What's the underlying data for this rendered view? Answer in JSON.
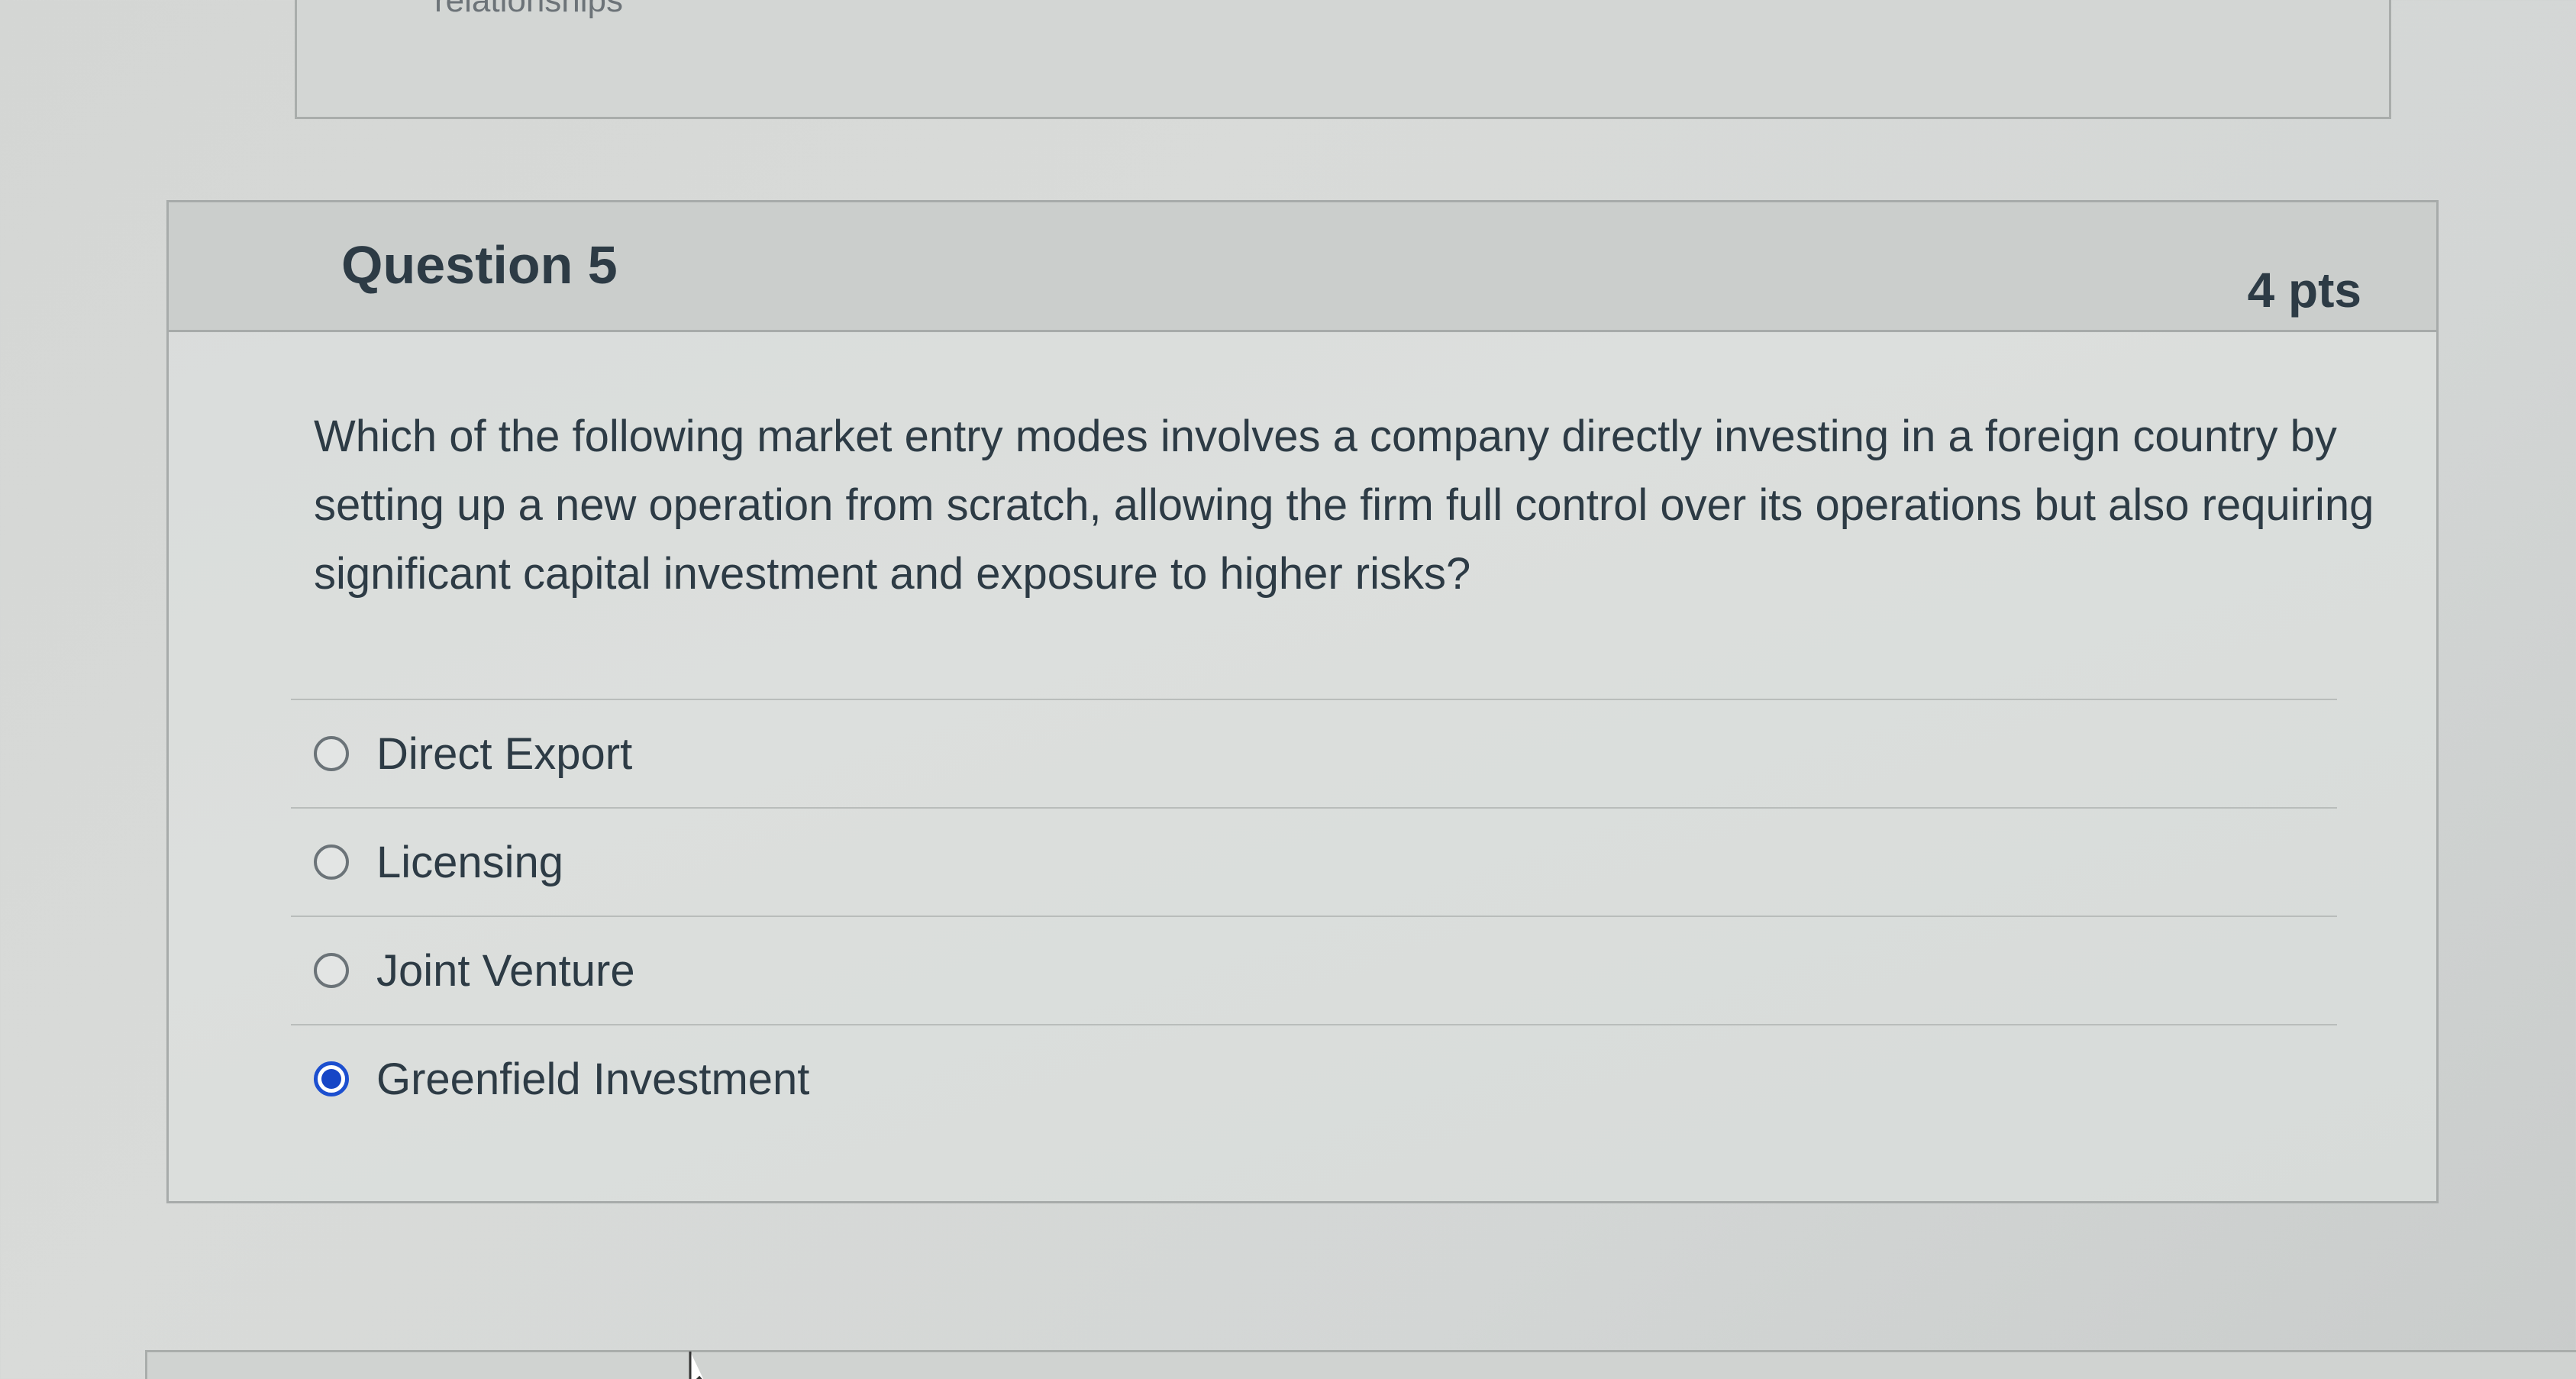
{
  "previous_question": {
    "cut_off_text": "relationships"
  },
  "question": {
    "title": "Question 5",
    "points": "4 pts",
    "text": "Which of the following market entry modes involves a company directly investing in a foreign country by setting up a new operation from scratch, allowing the firm full control over its operations but also requiring significant capital investment and exposure to higher risks?",
    "answers": [
      {
        "label": "Direct Export",
        "selected": false
      },
      {
        "label": "Licensing",
        "selected": false
      },
      {
        "label": "Joint Venture",
        "selected": false
      },
      {
        "label": "Greenfield Investment",
        "selected": true
      }
    ]
  },
  "icons": {
    "bookmark": "bookmark-flag-icon",
    "cursor": "mouse-pointer-icon"
  },
  "colors": {
    "selected_radio": "#1746c6",
    "text": "#2d3b45",
    "header_background": "#cbcecc"
  }
}
